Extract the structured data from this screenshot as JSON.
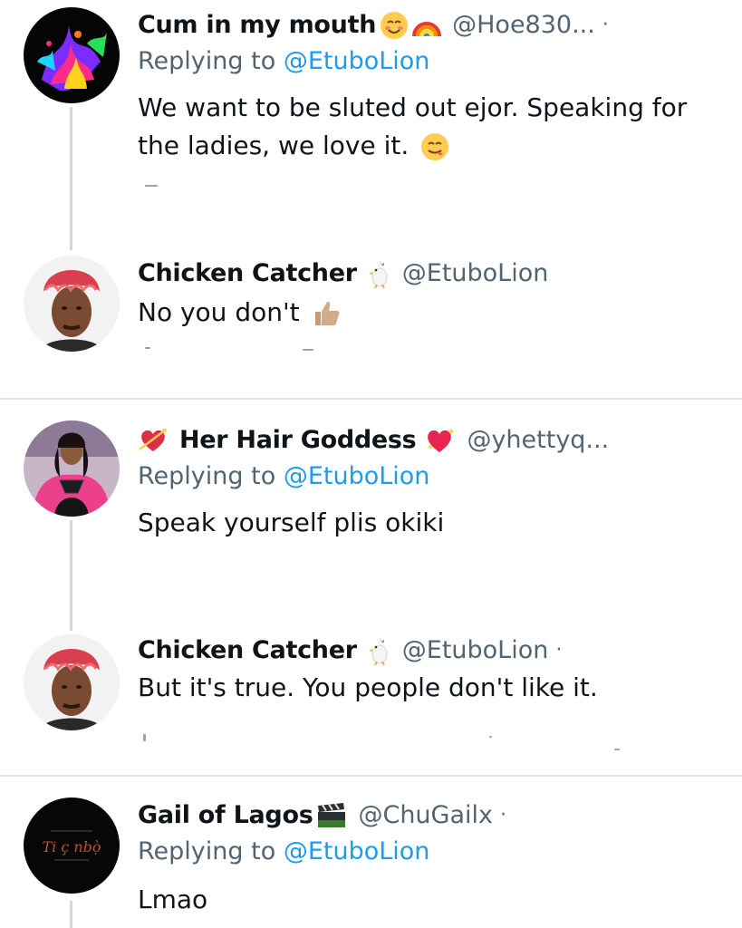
{
  "replying_prefix": "Replying to",
  "tweets": [
    {
      "name": "Cum in my mouth",
      "handle": "@Hoe830...",
      "separator": "·",
      "reply_to": "@EtuboLion",
      "text": "We want to be sluted out ejor. Speaking for the ladies, we love it.",
      "name_emoji": [
        "smiling-face-icon",
        "rainbow-icon"
      ],
      "text_emoji": [
        "yum-face-icon"
      ]
    },
    {
      "name": "Chicken Catcher",
      "handle": "@EtuboLion",
      "text": "No you don't",
      "name_emoji": [
        "chicken-icon"
      ],
      "text_emoji": [
        "thumbs-up-icon"
      ]
    },
    {
      "name": "Her Hair Goddess",
      "handle": "@yhettyq...",
      "reply_to": "@EtuboLion",
      "text": "Speak yourself plis okiki",
      "name_emoji": [
        "heart-arrow-icon",
        "sparkling-heart-icon"
      ]
    },
    {
      "name": "Chicken Catcher",
      "handle": "@EtuboLion",
      "separator": "·",
      "text": "But it's true. You people don't like it.",
      "name_emoji": [
        "chicken-icon"
      ]
    },
    {
      "name": "Gail of Lagos",
      "handle": "@ChuGailx",
      "separator": "·",
      "reply_to": "@EtuboLion",
      "text": "Lmao",
      "name_emoji": [
        "clapper-board-icon"
      ],
      "avatar_text": "Ti ç nbọ̀"
    }
  ],
  "colors": {
    "text": "#0f1419",
    "secondary": "#536471",
    "link": "#1d9bf0",
    "thread_line": "#cfd9de",
    "divider": "#e4e8eb"
  }
}
